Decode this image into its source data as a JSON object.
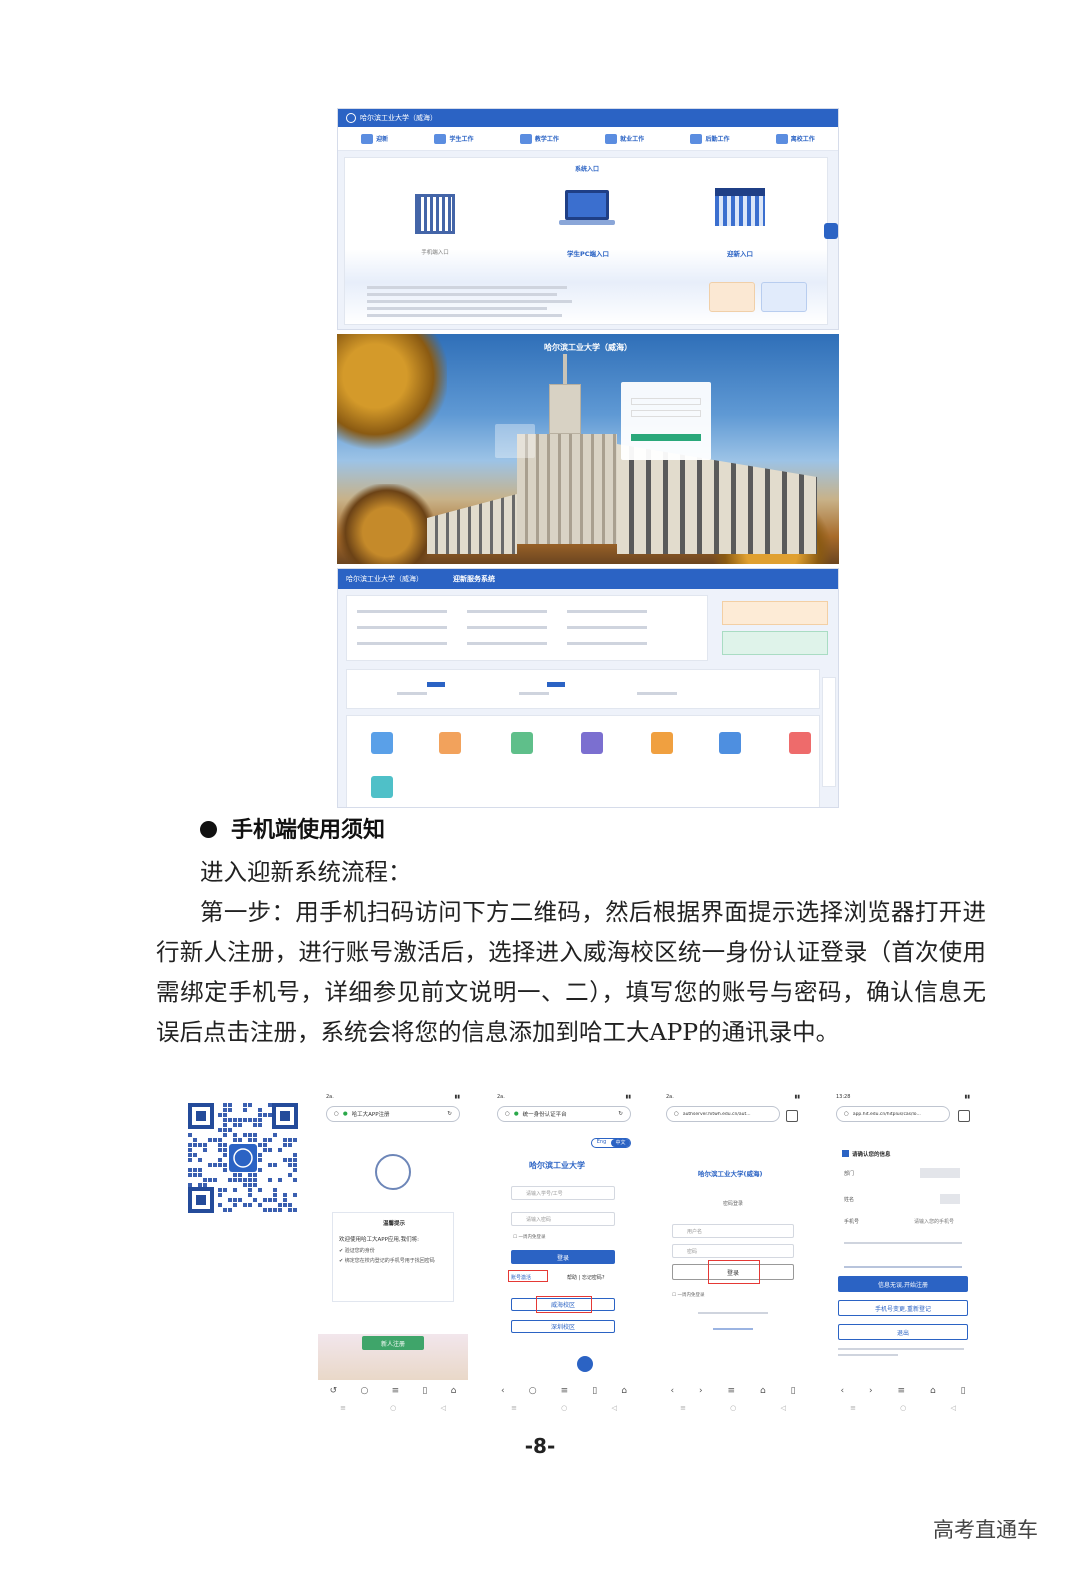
{
  "portal": {
    "school_name": "哈尔滨工业大学（威海）",
    "nav_items": [
      "迎新",
      "学生工作",
      "教学工作",
      "就业工作",
      "后勤工作",
      "离校工作"
    ],
    "entry_section": "系统入口",
    "entries": [
      "手机端入口",
      "学生PC端入口",
      "迎新入口"
    ]
  },
  "info_page": {
    "school_name": "哈尔滨工业大学（威海）",
    "title": "迎新服务系统"
  },
  "section": {
    "heading": "手机端使用须知",
    "intro": "进入迎新系统流程：",
    "body": "第一步：用手机扫码访问下方二维码，然后根据界面提示选择浏览器打开进行新人注册，进行账号激活后，选择进入威海校区统一身份认证登录（首次使用需绑定手机号，详细参见前文说明一、二），填写您的账号与密码，确认信息无误后点击注册，系统会将您的信息添加到哈工大APP的通讯录中。"
  },
  "phone1": {
    "url": "哈工大APP注册",
    "notice_title": "温馨提示",
    "notice_text": "欢迎使用哈工大APP应用,我们将:",
    "item1": "验证您的身份",
    "item2": "绑定您在校内登记的手机号用于找回密码",
    "button": "新人注册"
  },
  "phone2": {
    "url": "统一身份认证平台",
    "lang_en": "Eng",
    "lang_cn": "中文",
    "school": "哈尔滨工业大学",
    "username_ph": "请输入学号/工号",
    "password_ph": "请输入密码",
    "remember": "一周内免登录",
    "login": "登录",
    "activate": "账号激活",
    "help": "帮助",
    "forgot": "忘记密码?",
    "weihai": "威海校区",
    "shenzhen": "深圳校区"
  },
  "phone3": {
    "url": "authserver.hitwh.edu.cn/aut...",
    "school": "哈尔滨工业大学(威海)",
    "section": "密码登录",
    "username": "用户名",
    "password": "密码",
    "login": "登录",
    "remember": "一周内免登录"
  },
  "phone4": {
    "url": "app.hit.edu.cn/hitplus/cas/lo...",
    "title": "请确认您的信息",
    "dept_label": "部门",
    "name_label": "姓名",
    "phone_label": "手机号",
    "phone_ph": "请输入您的手机号",
    "confirm_button": "信息无误,开始注册",
    "rebind_button": "手机号变更,重新登记",
    "exit_button": "退出"
  },
  "page_number": "-8-",
  "watermark": "高考直通车"
}
